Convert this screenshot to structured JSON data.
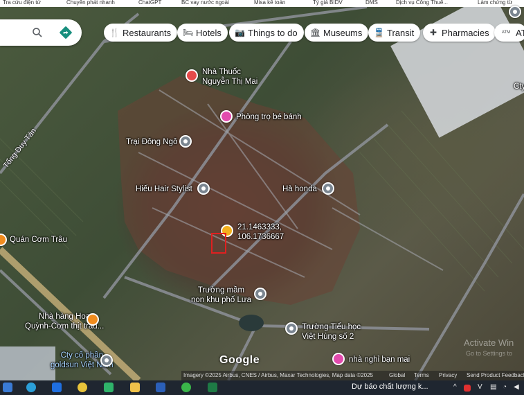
{
  "browser": {
    "bookmarks": [
      "Tra cứu điện tử",
      "Chuyển phát nhanh",
      "ChatGPT",
      "BC vay nước ngoài",
      "Misa kế toán",
      "Tỷ giá BIDV",
      "DMS",
      "Dịch vụ Công Thuế...",
      "Làm chứng từ"
    ]
  },
  "search": {
    "search_icon": "search-icon",
    "directions_icon": "directions-icon"
  },
  "chips": [
    {
      "label": "Restaurants",
      "icon": "restaurant-icon"
    },
    {
      "label": "Hotels",
      "icon": "hotel-icon"
    },
    {
      "label": "Things to do",
      "icon": "camera-icon"
    },
    {
      "label": "Museums",
      "icon": "museum-icon"
    },
    {
      "label": "Transit",
      "icon": "transit-icon"
    },
    {
      "label": "Pharmacies",
      "icon": "pharmacy-icon"
    },
    {
      "label": "AT",
      "icon": "atm-icon",
      "icon_text": "ATM"
    }
  ],
  "places": {
    "pharmacy": "Nhà Thuốc\nNguyễn Thị Mai",
    "boarding": "Phòng trọ bé bánh",
    "farm": "Trại Đông Ngô",
    "hair": "Hiếu Hair Stylist",
    "honda": "Hà honda",
    "com_trau": "Quán Cơm Trâu",
    "kindergarten": "Trường mầm\nnon khu phố Lưa",
    "restaurant": "Nhà hàng Hoa\nQuỳnh-Cơm thịt trâu...",
    "primary_school": "Trường Tiểu học\nViệt Hùng số 2",
    "company": "Cty cổ phần\ngoldsun Việt Nam",
    "guesthouse": "nhà nghỉ bạn mai",
    "partial_right": "Cty"
  },
  "coordinates": {
    "lat": "21.1463333,",
    "lng": "106.1736667"
  },
  "road": "Tổng Duy Tân",
  "logo": "Google",
  "attribution": {
    "imagery": "Imagery ©2025 Airbus, CNES / Airbus, Maxar Technologies, Map data ©2025",
    "global": "Global",
    "terms": "Terms",
    "privacy": "Privacy",
    "feedback": "Send Product Feedback"
  },
  "watermark": {
    "line1": "Activate Win",
    "line2": "Go to Settings to"
  },
  "taskbar": {
    "notification": "Dự báo chất lượng k..."
  },
  "colors": {
    "accent": "#1a73e8",
    "directions": "#188f7e"
  }
}
